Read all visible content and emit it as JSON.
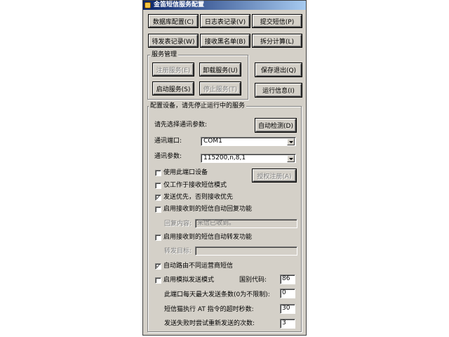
{
  "window": {
    "title": "金笛短信服务配置",
    "icon": "app-icon"
  },
  "top_buttons": {
    "db_config": "数据库配置(C)",
    "log_records": "日志表记录(V)",
    "submit_sms": "提交短信(P)",
    "pending_records": "待发表记录(W)",
    "blacklist": "接收黑名单(B)",
    "split_calc": "拆分计算(L)"
  },
  "service_group": {
    "label": "服务管理",
    "register": "注册服务(E)",
    "uninstall": "卸载服务(U)",
    "start": "启动服务(S)",
    "stop": "停止服务(T)"
  },
  "save_exit": "保存退出(Q)",
  "run_info": "运行信息(I)",
  "config_group": {
    "label": "配置设备，请先停止运行中的服务",
    "select_prompt": "请先选择通讯参数:",
    "auto_detect": "自动检测(D)",
    "port_label": "通讯端口:",
    "port_value": "COM1",
    "params_label": "通讯参数:",
    "params_value": "115200,n,8,1",
    "use_port": "使用此端口设备",
    "authorize": "授权注册(A)",
    "receive_only": "仅工作于接收短信模式",
    "send_first": "发送优先，否则接收优先",
    "auto_reply": "启用接收到的短信自动回复功能",
    "reply_content_label": "回复内容:",
    "reply_content_value": "来信已收到。",
    "auto_forward": "启用接收到的短信自动转发功能",
    "forward_target_label": "转发目标:",
    "forward_target_value": "",
    "auto_route": "自动路由不同运营商短信",
    "simulate_send": "启用模拟发送模式",
    "country_code_label": "国别代码:",
    "country_code_value": "86",
    "max_daily_label": "此端口每天最大发送条数(0为不限制):",
    "max_daily_value": "0",
    "at_timeout_label": "短信猫执行 AT 指令的超时秒数:",
    "at_timeout_value": "30",
    "retry_label": "发送失败时尝试重新发送的次数:",
    "retry_value": "3"
  },
  "checks": {
    "use_port": false,
    "receive_only": false,
    "send_first": true,
    "auto_reply": false,
    "auto_forward": false,
    "auto_route": true,
    "simulate_send": false
  },
  "check_mark": "✓"
}
